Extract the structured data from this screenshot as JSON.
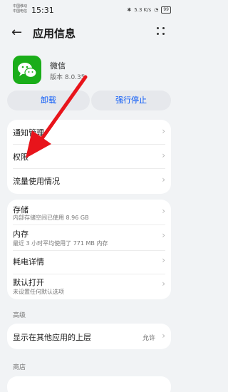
{
  "status_bar": {
    "carrier1": "中国移动",
    "carrier2": "中国电信",
    "time": "15:31",
    "net_speed": "5.3 K/s",
    "battery": "99"
  },
  "header": {
    "title": "应用信息"
  },
  "app": {
    "name": "微信",
    "version": "版本 8.0.35",
    "icon_color": "#1aad19"
  },
  "actions": {
    "uninstall": "卸载",
    "force_stop": "强行停止",
    "accent": "#0a59f7"
  },
  "card1": [
    {
      "label": "通知管理"
    },
    {
      "label": "权限"
    },
    {
      "label": "流量使用情况"
    }
  ],
  "card2": [
    {
      "label": "存储",
      "sub": "内部存储空间已使用 8.96 GB"
    },
    {
      "label": "内存",
      "sub": "最近 3 小时平均使用了 771 MB 内存"
    },
    {
      "label": "耗电详情"
    },
    {
      "label": "默认打开",
      "sub": "未设置任何默认选项"
    }
  ],
  "sections": {
    "advanced": "高级",
    "store": "商店"
  },
  "card3": {
    "label": "显示在其他应用的上层",
    "value": "允许"
  },
  "annotation": {
    "arrow_color": "#e8141b"
  }
}
